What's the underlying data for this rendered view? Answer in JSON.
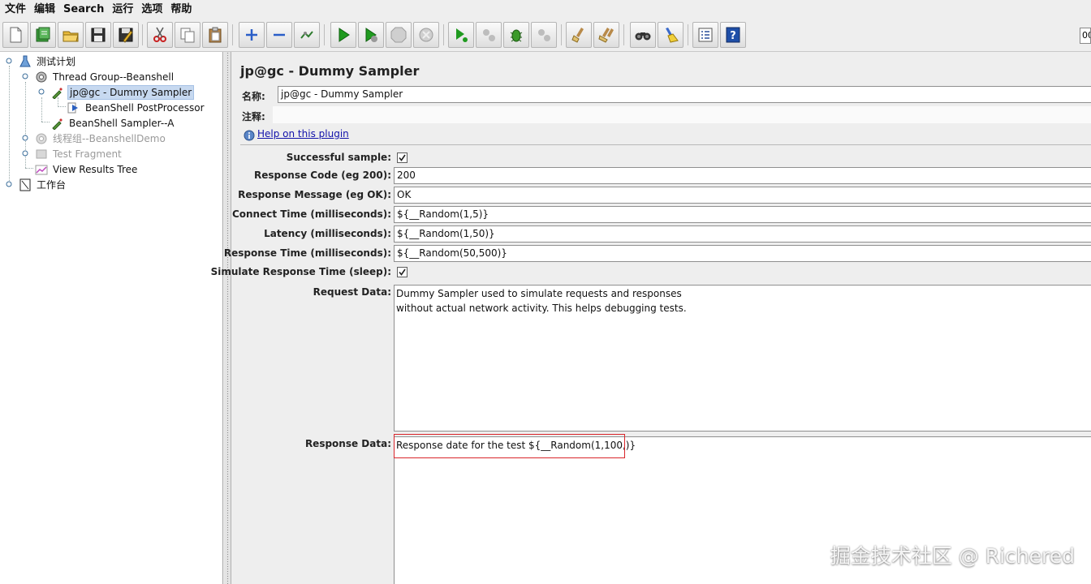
{
  "menu": [
    "文件",
    "编辑",
    "Search",
    "运行",
    "选项",
    "帮助"
  ],
  "toolbar": {
    "counter": "00",
    "buttons": [
      "new-icon",
      "templates-icon",
      "open-icon",
      "save-icon",
      "save-as-icon",
      "cut-icon",
      "copy-icon",
      "paste-icon",
      "expand-icon",
      "collapse-icon",
      "toggle-icon",
      "start-icon",
      "start-no-pause-icon",
      "stop-icon",
      "shutdown-icon",
      "remote-start-icon",
      "remote-stop-icon",
      "remote-start-all-icon",
      "remote-exit-icon",
      "clear-icon",
      "clear-all-icon",
      "search-icon",
      "reset-search-icon",
      "function-helper-icon",
      "help-icon"
    ]
  },
  "tree": {
    "items": [
      {
        "label": "测试计划",
        "icon": "test-plan-icon",
        "disabled": false,
        "selected": false
      },
      {
        "label": "Thread Group--Beanshell",
        "icon": "thread-group-icon",
        "disabled": false,
        "selected": false
      },
      {
        "label": "jp@gc - Dummy Sampler",
        "icon": "sampler-icon",
        "disabled": false,
        "selected": true
      },
      {
        "label": "BeanShell PostProcessor",
        "icon": "post-processor-icon",
        "disabled": false,
        "selected": false
      },
      {
        "label": "BeanShell Sampler--A",
        "icon": "sampler-icon",
        "disabled": false,
        "selected": false
      },
      {
        "label": "线程组--BeanshellDemo",
        "icon": "thread-group-icon",
        "disabled": true,
        "selected": false
      },
      {
        "label": "Test Fragment",
        "icon": "test-fragment-icon",
        "disabled": true,
        "selected": false
      },
      {
        "label": "View Results Tree",
        "icon": "results-tree-icon",
        "disabled": false,
        "selected": false
      },
      {
        "label": "工作台",
        "icon": "workbench-icon",
        "disabled": false,
        "selected": false
      }
    ]
  },
  "panel": {
    "title": "jp@gc - Dummy Sampler",
    "name_label": "名称:",
    "name_value": "jp@gc - Dummy Sampler",
    "comment_label": "注释:",
    "comment_value": "",
    "help_link": "Help on this plugin"
  },
  "fields": {
    "successful_sample": {
      "label": "Successful sample:",
      "checked": true
    },
    "response_code": {
      "label": "Response Code (eg 200):",
      "value": "200"
    },
    "response_message": {
      "label": "Response Message (eg OK):",
      "value": "OK"
    },
    "connect_time": {
      "label": "Connect Time (milliseconds):",
      "value": "${__Random(1,5)}"
    },
    "latency": {
      "label": "Latency (milliseconds):",
      "value": "${__Random(1,50)}"
    },
    "response_time": {
      "label": "Response Time (milliseconds):",
      "value": "${__Random(50,500)}"
    },
    "simulate_sleep": {
      "label": "Simulate Response Time (sleep):",
      "checked": true
    },
    "request_data": {
      "label": "Request Data:",
      "value": "Dummy Sampler used to simulate requests and responses\nwithout actual network activity. This helps debugging tests."
    },
    "response_data": {
      "label": "Response Data:",
      "value": "Response date for the test ${__Random(1,100,)}"
    }
  },
  "watermark": "掘金技术社区 @ Richered",
  "colors": {
    "highlight": "#d9262b",
    "link": "#1111aa",
    "selection": "#c7d9f0"
  }
}
